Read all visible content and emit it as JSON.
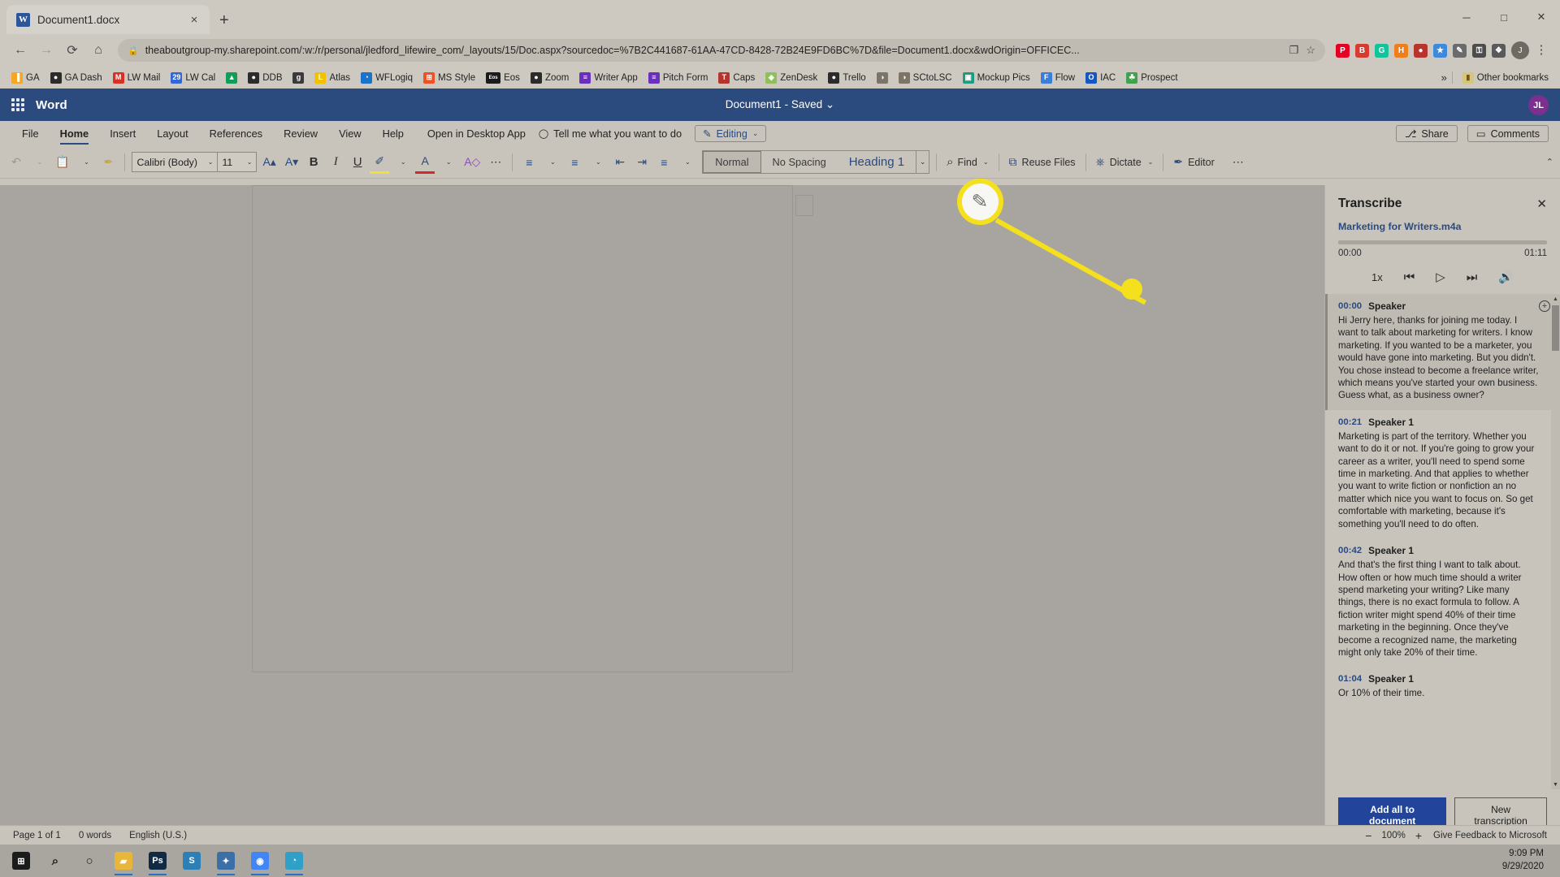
{
  "browser": {
    "tab": {
      "title": "Document1.docx",
      "favicon_label": "W",
      "close_icon": "×"
    },
    "new_tab_icon": "+",
    "window_controls": {
      "minimize": "─",
      "maximize": "□",
      "close": "✕"
    },
    "nav": {
      "back": "←",
      "forward": "→",
      "reload": "⟳",
      "home": "⌂"
    },
    "omnibox": {
      "lock_icon": "🔒",
      "url": "theaboutgroup-my.sharepoint.com/:w:/r/personal/jledford_lifewire_com/_layouts/15/Doc.aspx?sourcedoc=%7B2C441687-61AA-47CD-8428-72B24E9FD6BC%7D&file=Document1.docx&wdOrigin=OFFICEC...",
      "share_icon": "❐",
      "star_icon": "☆"
    },
    "extensions": [
      {
        "name": "pinterest-extension-icon",
        "glyph": "P",
        "color": "#e60023"
      },
      {
        "name": "bitmoji-extension-icon",
        "glyph": "B",
        "color": "#d73a2e"
      },
      {
        "name": "grammarly-extension-icon",
        "glyph": "G",
        "color": "#15c39a"
      },
      {
        "name": "honey-extension-icon",
        "glyph": "H",
        "color": "#ef7f1a"
      },
      {
        "name": "record-extension-icon",
        "glyph": "●",
        "color": "#b8342c"
      },
      {
        "name": "star-extension-icon",
        "glyph": "★",
        "color": "#3c8adb"
      },
      {
        "name": "pen-extension-icon",
        "glyph": "✎",
        "color": "#6b6b6b"
      },
      {
        "name": "key-extension-icon",
        "glyph": "⚿",
        "color": "#4c4c4c"
      },
      {
        "name": "puzzle-extension-icon",
        "glyph": "❖",
        "color": "#5a5a5a"
      }
    ],
    "profile_initial": "J",
    "menu_icon": "⋮",
    "bookmarks": [
      {
        "label": "GA",
        "icon": "bar-chart-icon",
        "glyph": "▐",
        "color": "#f5a623"
      },
      {
        "label": "GA Dash",
        "icon": "globe-icon",
        "glyph": "●",
        "color": "#2b2b2b"
      },
      {
        "label": "LW Mail",
        "icon": "gmail-icon",
        "glyph": "M",
        "color": "#d93025"
      },
      {
        "label": "LW Cal",
        "icon": "calendar-icon",
        "glyph": "29",
        "color": "#3367d6"
      },
      {
        "label": "",
        "icon": "google-drive-icon",
        "glyph": "▲",
        "color": "#0f9d58"
      },
      {
        "label": "DDB",
        "icon": "globe-icon",
        "glyph": "●",
        "color": "#2b2b2b"
      },
      {
        "label": "",
        "icon": "grid-icon",
        "glyph": "g",
        "color": "#3a3a3a"
      },
      {
        "label": "Atlas",
        "icon": "atlas-icon",
        "glyph": "L",
        "color": "#f2c200"
      },
      {
        "label": "WFLogiq",
        "icon": "clock-icon",
        "glyph": "◔",
        "color": "#1a73c9"
      },
      {
        "label": "MS Style",
        "icon": "microsoft-icon",
        "glyph": "⊞",
        "color": "#f25022"
      },
      {
        "label": "Eos",
        "icon": "eos-icon",
        "glyph": "Eos",
        "color": "#1b1b1b"
      },
      {
        "label": "Zoom",
        "icon": "globe-icon",
        "glyph": "●",
        "color": "#2b2b2b"
      },
      {
        "label": "Writer App",
        "icon": "list-icon",
        "glyph": "≡",
        "color": "#6b2fbf"
      },
      {
        "label": "Pitch Form",
        "icon": "list-icon",
        "glyph": "≡",
        "color": "#6b2fbf"
      },
      {
        "label": "Caps",
        "icon": "text-icon",
        "glyph": "T",
        "color": "#b5342c"
      },
      {
        "label": "ZenDesk",
        "icon": "zendesk-icon",
        "glyph": "◈",
        "color": "#8fbf5a"
      },
      {
        "label": "Trello",
        "icon": "globe-icon",
        "glyph": "●",
        "color": "#2b2b2b"
      },
      {
        "label": "",
        "icon": "avatar-icon",
        "glyph": "◑",
        "color": "#7d7468"
      },
      {
        "label": "SCtoLSC",
        "icon": "avatar-icon",
        "glyph": "◑",
        "color": "#7d7468"
      },
      {
        "label": "Mockup Pics",
        "icon": "image-icon",
        "glyph": "▣",
        "color": "#1f9b82"
      },
      {
        "label": "Flow",
        "icon": "flow-icon",
        "glyph": "F",
        "color": "#3b7dd8"
      },
      {
        "label": "IAC",
        "icon": "circle-icon",
        "glyph": "O",
        "color": "#1656c2"
      },
      {
        "label": "Prospect",
        "icon": "leaf-icon",
        "glyph": "☘",
        "color": "#3fa34d"
      }
    ],
    "bookmarks_overflow_icon": "»",
    "other_bookmarks": {
      "label": "Other bookmarks",
      "icon": "folder-icon",
      "glyph": "▰",
      "color": "#d8c47a"
    }
  },
  "word": {
    "app_name": "Word",
    "waffle_icon": "app-launcher-icon",
    "document_title": "Document1",
    "save_state": "Saved",
    "save_caret": "⌄",
    "user_initials": "JL",
    "ribbon_tabs": [
      {
        "label": "File",
        "active": false
      },
      {
        "label": "Home",
        "active": true
      },
      {
        "label": "Insert",
        "active": false
      },
      {
        "label": "Layout",
        "active": false
      },
      {
        "label": "References",
        "active": false
      },
      {
        "label": "Review",
        "active": false
      },
      {
        "label": "View",
        "active": false
      },
      {
        "label": "Help",
        "active": false
      }
    ],
    "open_desktop": "Open in Desktop App",
    "tell_me": {
      "label": "Tell me what you want to do",
      "icon": "lightbulb-icon",
      "glyph": "◯"
    },
    "editing_mode": {
      "label": "Editing",
      "icon": "pencil-icon",
      "glyph": "✎",
      "caret": "⌄"
    },
    "share_button": {
      "label": "Share",
      "icon": "share-icon",
      "glyph": "⎇"
    },
    "comments_button": {
      "label": "Comments",
      "icon": "comment-icon",
      "glyph": "▭"
    },
    "toolbar": {
      "undo": {
        "name": "undo-icon",
        "glyph": "↶"
      },
      "paste": {
        "name": "paste-icon",
        "glyph": "Ὄb"
      },
      "format_painter": {
        "name": "format-painter-icon",
        "glyph": "✎"
      },
      "font_name": "Calibri (Body)",
      "font_size": "11",
      "grow_font": {
        "name": "grow-font-icon",
        "glyph": "A"
      },
      "shrink_font": {
        "name": "shrink-font-icon",
        "glyph": "A"
      },
      "bold": {
        "name": "bold-icon",
        "glyph": "B"
      },
      "italic": {
        "name": "italic-icon",
        "glyph": "I"
      },
      "underline": {
        "name": "underline-icon",
        "glyph": "U"
      },
      "highlight": {
        "name": "highlight-icon",
        "glyph": "✐"
      },
      "font_color": {
        "name": "font-color-icon",
        "glyph": "A"
      },
      "clear_formatting": {
        "name": "clear-formatting-icon",
        "glyph": "A"
      },
      "more_font": {
        "name": "more-options-icon",
        "glyph": "⋯"
      },
      "bullets": {
        "name": "bullet-list-icon",
        "glyph": "☰"
      },
      "numbering": {
        "name": "numbered-list-icon",
        "glyph": "☰"
      },
      "decrease_indent": {
        "name": "decrease-indent-icon",
        "glyph": "⇤"
      },
      "increase_indent": {
        "name": "increase-indent-icon",
        "glyph": "⇥"
      },
      "align": {
        "name": "align-icon",
        "glyph": "☰"
      },
      "caret": "⌄"
    },
    "styles": [
      {
        "label": "Normal",
        "selected": true
      },
      {
        "label": "No Spacing",
        "selected": false
      },
      {
        "label": "Heading 1",
        "selected": false
      }
    ],
    "styles_more_caret": "⌄",
    "find": {
      "label": "Find",
      "icon": "search-icon",
      "glyph": "⌕",
      "caret": "⌄"
    },
    "reuse_files": {
      "label": "Reuse Files",
      "icon": "reuse-files-icon",
      "glyph": "⧉"
    },
    "dictate": {
      "label": "Dictate",
      "icon": "microphone-icon",
      "glyph": "☷",
      "caret": "⌄"
    },
    "editor": {
      "label": "Editor",
      "icon": "editor-icon",
      "glyph": "✎"
    },
    "more_commands": {
      "name": "more-commands-icon",
      "glyph": "⋯"
    },
    "collapse_ribbon": {
      "name": "collapse-ribbon-icon",
      "glyph": "⌃"
    }
  },
  "transcribe": {
    "title": "Transcribe",
    "close_icon": "✕",
    "audio_file": "Marketing for Writers.m4a",
    "time_current": "00:00",
    "time_total": "01:11",
    "controls": {
      "speed": "1x",
      "rewind": {
        "name": "rewind-icon",
        "glyph": "⏮"
      },
      "play": {
        "name": "play-icon",
        "glyph": "▷"
      },
      "forward": {
        "name": "fast-forward-icon",
        "glyph": "⏭"
      },
      "volume": {
        "name": "volume-icon",
        "glyph": "🔊"
      }
    },
    "scroll": {
      "up_arrow": "▲",
      "down_arrow": "▼"
    },
    "segments": [
      {
        "time": "00:00",
        "speaker": "Speaker",
        "text": "Hi Jerry here, thanks for joining me today. I want to talk about marketing for writers. I know marketing. If you wanted to be a marketer, you would have gone into marketing. But you didn't. You chose instead to become a freelance writer, which means you've started your own business. Guess what, as a business owner?",
        "add_icon": "⊕"
      },
      {
        "time": "00:21",
        "speaker": "Speaker 1",
        "text": "Marketing is part of the territory. Whether you want to do it or not. If you're going to grow your career as a writer, you'll need to spend some time in marketing. And that applies to whether you want to write fiction or nonfiction an no matter which nice you want to focus on. So get comfortable with marketing, because it's something you'll need to do often.",
        "add_icon": ""
      },
      {
        "time": "00:42",
        "speaker": "Speaker 1",
        "text": "And that's the first thing I want to talk about. How often or how much time should a writer spend marketing your writing? Like many things, there is no exact formula to follow. A fiction writer might spend 40% of their time marketing in the beginning. Once they've become a recognized name, the marketing might only take 20% of their time.",
        "add_icon": ""
      },
      {
        "time": "01:04",
        "speaker": "Speaker 1",
        "text": "Or 10% of their time.",
        "add_icon": ""
      }
    ],
    "add_all_button": "Add all to document",
    "new_transcription_button": "New transcription"
  },
  "status_bar": {
    "page": "Page 1 of 1",
    "words": "0 words",
    "language": "English (U.S.)",
    "zoom_out": "−",
    "zoom_level": "100%",
    "zoom_in": "+",
    "feedback": "Give Feedback to Microsoft"
  },
  "taskbar": {
    "items": [
      {
        "name": "start-button",
        "glyph": "⊞",
        "color": "#1b1b1b",
        "running": false
      },
      {
        "name": "search-icon",
        "glyph": "⌕",
        "color": "transparent",
        "running": false
      },
      {
        "name": "task-view-icon",
        "glyph": "○",
        "color": "transparent",
        "running": false
      },
      {
        "name": "file-explorer-icon",
        "glyph": "▰",
        "color": "#e8b63a",
        "running": true
      },
      {
        "name": "photoshop-icon",
        "glyph": "Ps",
        "color": "#102a45",
        "running": true
      },
      {
        "name": "snagit-icon",
        "glyph": "S",
        "color": "#2d7fb8",
        "running": false
      },
      {
        "name": "slack-icon",
        "glyph": "✦",
        "color": "#3a6fa8",
        "running": true
      },
      {
        "name": "chrome-icon",
        "glyph": "◉",
        "color": "#4285f4",
        "running": true
      },
      {
        "name": "edge-icon",
        "glyph": "◔",
        "color": "#2fa0c8",
        "running": true
      }
    ],
    "clock_time": "9:09 PM",
    "clock_date": "9/29/2020"
  },
  "callout": {
    "magnifier_icon": "pencil-icon",
    "magnifier_glyph": "✎",
    "highlight_color": "#f5e01e"
  }
}
